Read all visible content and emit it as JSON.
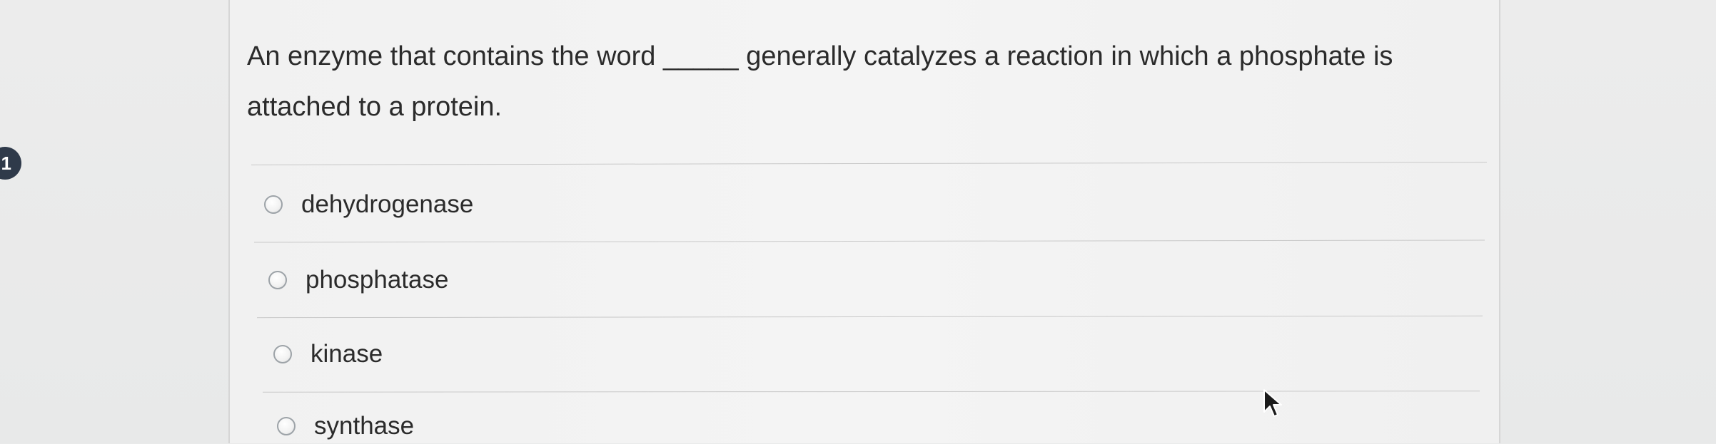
{
  "question": {
    "number": "1",
    "text": "An enzyme that contains the word _____ generally catalyzes a reaction in which a phosphate is attached to a protein."
  },
  "options": [
    {
      "label": "dehydrogenase",
      "selected": false
    },
    {
      "label": "phosphatase",
      "selected": false
    },
    {
      "label": "kinase",
      "selected": false
    },
    {
      "label": "synthase",
      "selected": false
    }
  ],
  "cursor": {
    "icon": "arrow-cursor-icon"
  }
}
